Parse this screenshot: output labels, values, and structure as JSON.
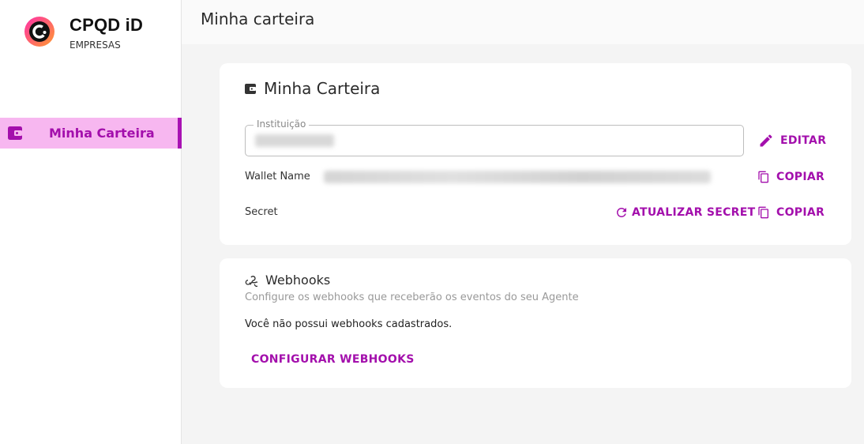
{
  "brand": {
    "name": "CPQD iD",
    "subtitle": "EMPRESAS"
  },
  "sidebar": {
    "items": [
      {
        "label": "Minha Carteira",
        "icon": "wallet-icon",
        "active": true
      }
    ]
  },
  "header": {
    "title": "Minha carteira"
  },
  "wallet_card": {
    "title": "Minha Carteira",
    "icon": "wallet-icon",
    "institution_label": "Instituição",
    "edit_label": "EDITAR",
    "wallet_name_label": "Wallet Name",
    "copy_label": "COPIAR",
    "secret_label": "Secret",
    "refresh_secret_label": "ATUALIZAR SECRET",
    "copy_secret_label": "COPIAR"
  },
  "webhooks_card": {
    "title": "Webhooks",
    "icon": "webhook-icon",
    "subtitle": "Configure os webhooks que receberão os eventos do seu Agente",
    "empty_text": "Você não possui webhooks cadastrados.",
    "configure_label": "CONFIGURAR WEBHOOKS"
  },
  "colors": {
    "accent": "#a30fac",
    "active_bg": "#f7b7f0"
  }
}
